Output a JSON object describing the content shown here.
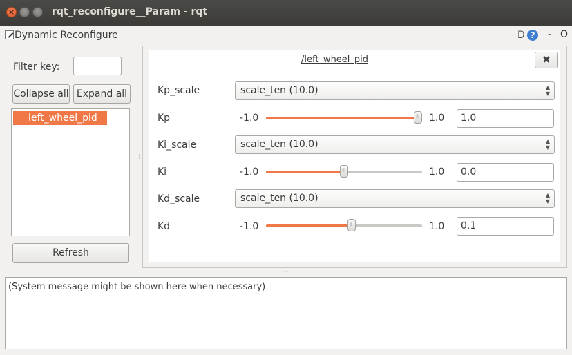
{
  "window": {
    "title": "rqt_reconfigure__Param - rqt"
  },
  "plugin": {
    "title": "Dynamic Reconfigure",
    "d_label": "D",
    "help_label": "?",
    "minimize_label": "-",
    "close_label": "O"
  },
  "left": {
    "filter_label": "Filter key:",
    "filter_value": "",
    "collapse_label": "Collapse all",
    "expand_label": "Expand all",
    "tree_items": [
      "left_wheel_pid"
    ],
    "refresh_label": "Refresh"
  },
  "node": {
    "title": "/left_wheel_pid",
    "close_label": "✖",
    "params": [
      {
        "name": "Kp_scale",
        "type": "enum",
        "value": "scale_ten (10.0)"
      },
      {
        "name": "Kp",
        "type": "double",
        "min": "-1.0",
        "max": "1.0",
        "value": "1.0",
        "fraction": 1.0
      },
      {
        "name": "Ki_scale",
        "type": "enum",
        "value": "scale_ten (10.0)"
      },
      {
        "name": "Ki",
        "type": "double",
        "min": "-1.0",
        "max": "1.0",
        "value": "0.0",
        "fraction": 0.5
      },
      {
        "name": "Kd_scale",
        "type": "enum",
        "value": "scale_ten (10.0)"
      },
      {
        "name": "Kd",
        "type": "double",
        "min": "-1.0",
        "max": "1.0",
        "value": "0.1",
        "fraction": 0.55
      }
    ]
  },
  "system_message": "(System message might be shown here when necessary)",
  "colors": {
    "accent": "#f07746",
    "titlebar": "#3c3b37"
  }
}
